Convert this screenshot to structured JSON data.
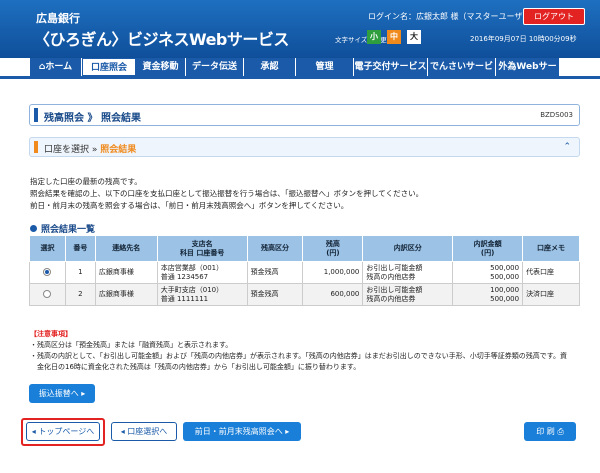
{
  "header": {
    "bank": "広島銀行",
    "service": "〈ひろぎん〉ビジネスWebサービス",
    "login": "ログイン名：広銀太郎 様（マスターユーザ）",
    "logout": "ログアウト",
    "fontsize_label": "文字サイズを変更",
    "fs_small": "小",
    "fs_medium": "中",
    "fs_large": "大",
    "datetime": "2016年09月07日 10時00分09秒"
  },
  "nav": [
    {
      "label": "ホーム"
    },
    {
      "label": "口座照会"
    },
    {
      "label": "資金移動"
    },
    {
      "label": "データ伝送"
    },
    {
      "label": "承認"
    },
    {
      "label": "管理"
    },
    {
      "label": "電子交付サービス"
    },
    {
      "label": "でんさいサービス"
    },
    {
      "label": "外為Webサービス"
    }
  ],
  "page": {
    "title": "残高照会 》 照会結果",
    "code": "BZDS003",
    "step1": "口座を選択",
    "step2": "照会結果",
    "desc": [
      "指定した口座の最新の残高です。",
      "照会結果を確認の上、以下の口座を支払口座として振込振替を行う場合は、「振込振替へ」ボタンを押してください。",
      "前日・前月末の残高を照会する場合は、「前日・前月末残高照会へ」ボタンを押してください。"
    ],
    "section": "照会結果一覧"
  },
  "table": {
    "headers": [
      "選択",
      "番号",
      "連絡先名",
      "支店名\n科目 口座番号",
      "残高区分",
      "残高\n(円)",
      "内訳区分",
      "内訳金額\n(円)",
      "口座メモ"
    ],
    "rows": [
      {
        "no": "1",
        "name": "広銀商事様",
        "branch": "本店営業部（001）",
        "acct": "普通 1234567",
        "type": "預金残高",
        "bal": "1,000,000",
        "k1": "お引出し可能金額",
        "k2": "残高の内他店券",
        "a1": "500,000",
        "a2": "500,000",
        "memo": "代表口座"
      },
      {
        "no": "2",
        "name": "広銀商事様",
        "branch": "大手町支店（010）",
        "acct": "普通 1111111",
        "type": "預金残高",
        "bal": "600,000",
        "k1": "お引出し可能金額",
        "k2": "残高の内他店券",
        "a1": "100,000",
        "a2": "500,000",
        "memo": "決済口座"
      }
    ]
  },
  "notes": {
    "head": "【注意事項】",
    "l1": "・残高区分は「預金残高」または「融資残高」と表示されます。",
    "l2": "・残高の内訳として、「お引出し可能金額」および「残高の内他店券」が表示されます。「残高の内他店券」はまだお引出しのできない手形、小切手等証券類の残高です。資",
    "l3": "　金化日の16時に資金化された残高は「残高の内他店券」から「お引出し可能金額」に振り替わります。"
  },
  "buttons": {
    "transfer": "振込振替へ ▸",
    "top": "◂ トップページへ",
    "select": "◂ 口座選択へ",
    "prev": "前日・前月末残高照会へ ▸",
    "print": "印 刷 ⎙"
  }
}
